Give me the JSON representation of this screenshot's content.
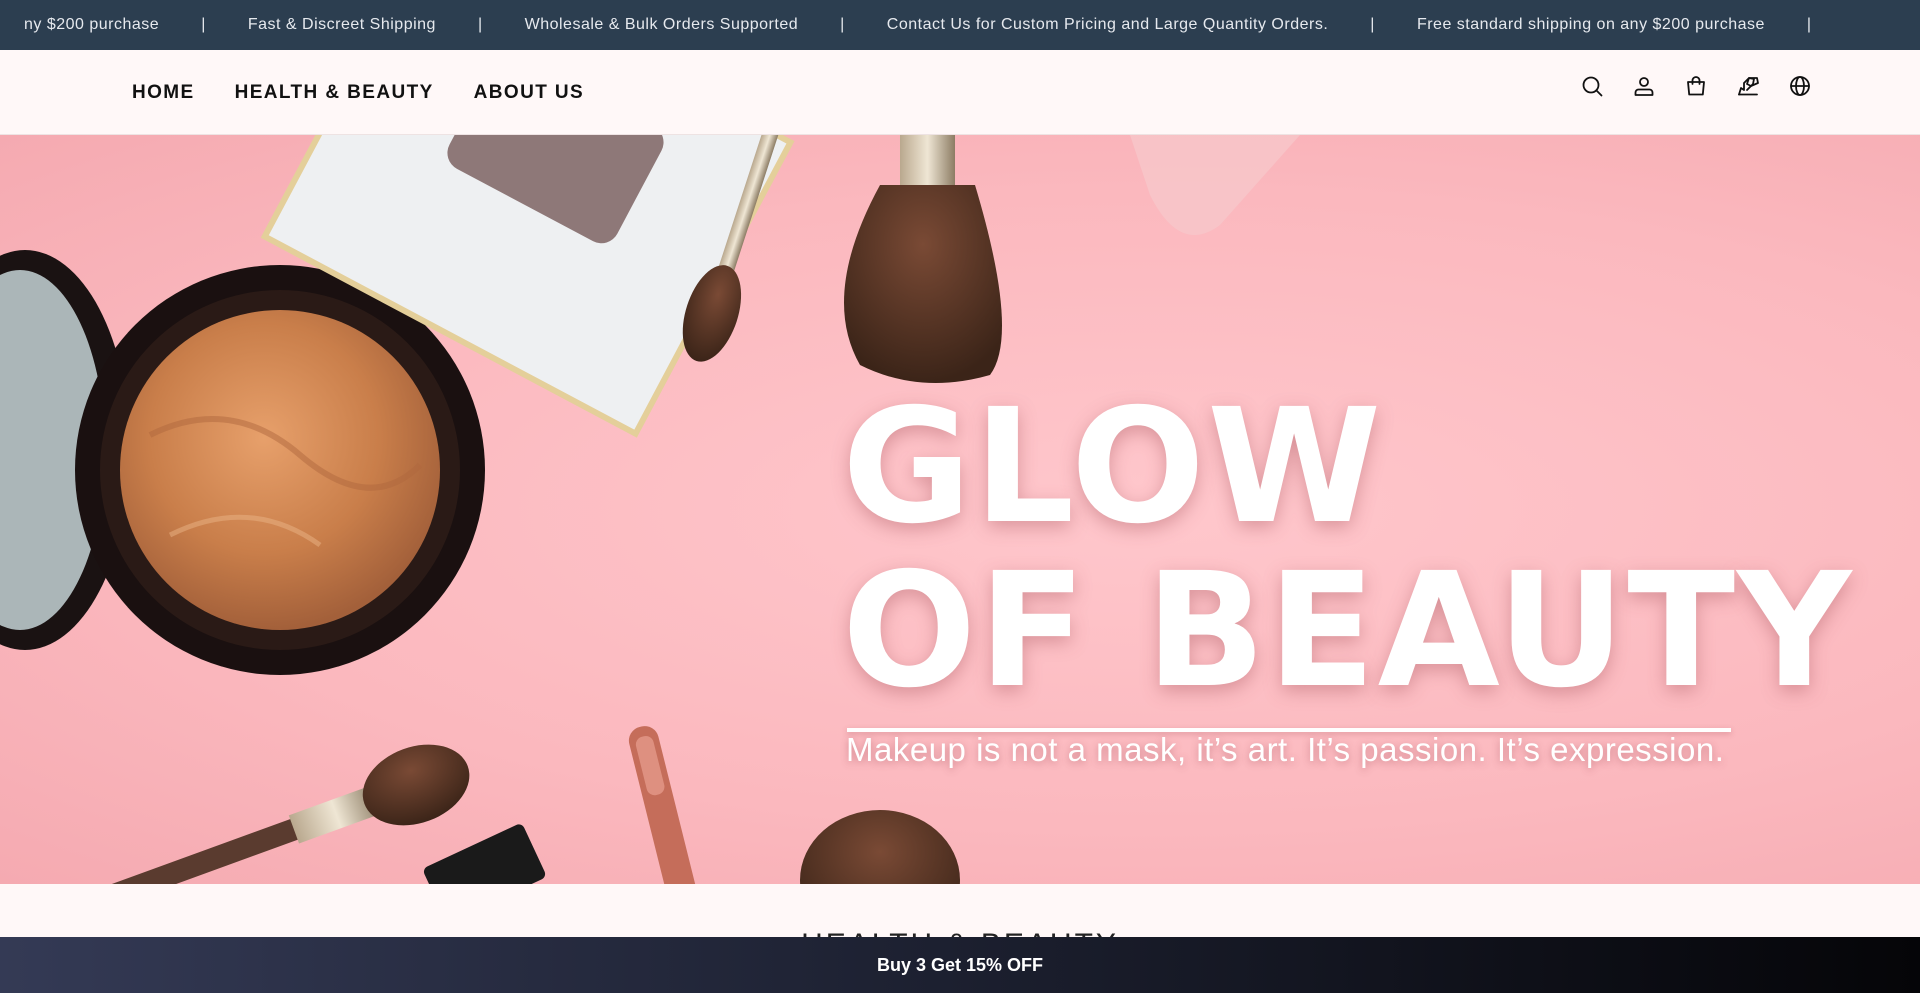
{
  "announcement": {
    "items": [
      "ny $200 purchase",
      "Fast & Discreet Shipping",
      "Wholesale & Bulk Orders Supported",
      "Contact Us for Custom Pricing and Large Quantity Orders.",
      "Free standard shipping on any $200 purchase"
    ],
    "separator": "|"
  },
  "nav": {
    "items": [
      "HOME",
      "HEALTH & BEAUTY",
      "ABOUT US"
    ]
  },
  "header_icons": [
    "search-icon",
    "account-icon",
    "cart-icon",
    "wishlist-icon",
    "globe-icon"
  ],
  "hero": {
    "title_line1": "GLOW",
    "title_line2": "OF BEAUTY",
    "subtitle": "Makeup is not a mask, it’s art. It’s passion. It’s expression.",
    "background_color": "#fbb8be"
  },
  "section": {
    "title": "HEALTH & BEAUTY"
  },
  "promo": {
    "label": "Buy 3 Get 15% OFF"
  },
  "colors": {
    "announcement_bg": "#2c3e50",
    "page_bg": "#fff8f8",
    "promo_bg": "#1e2233"
  }
}
